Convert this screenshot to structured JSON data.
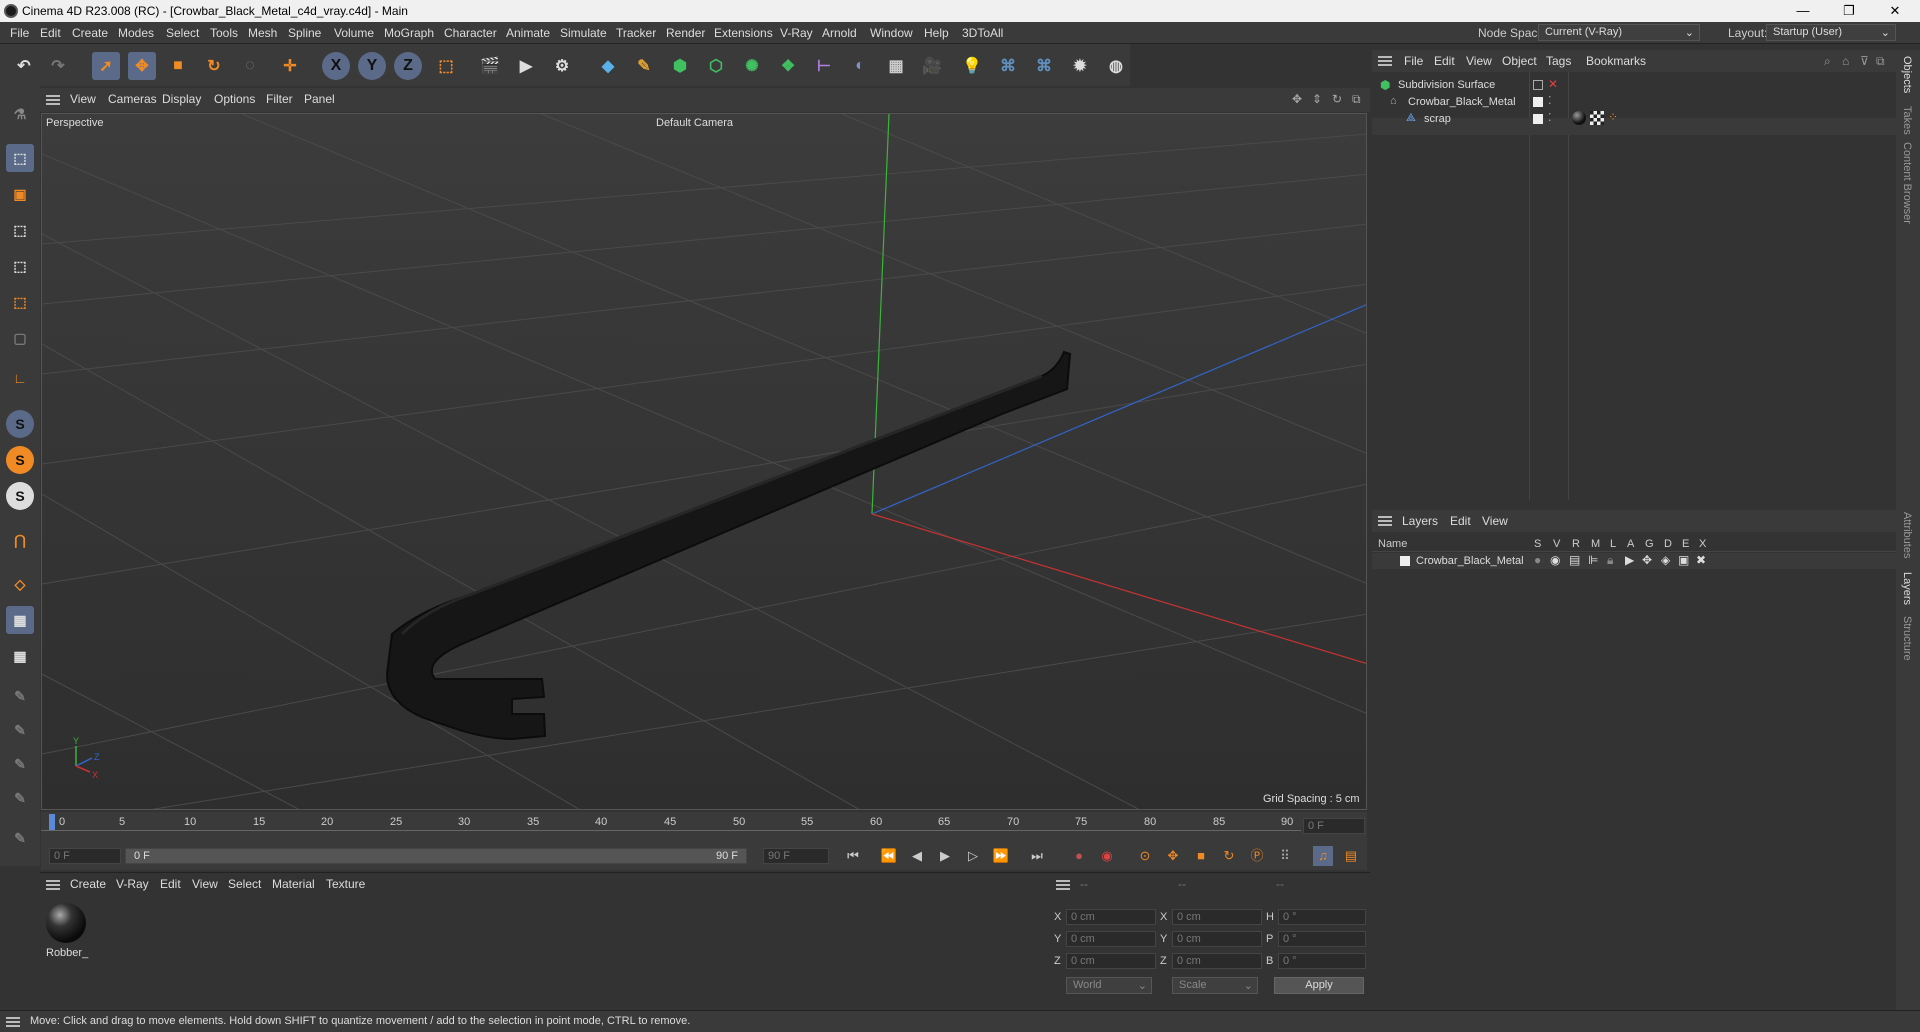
{
  "title": "Cinema 4D R23.008 (RC) - [Crowbar_Black_Metal_c4d_vray.c4d] - Main",
  "window_controls": {
    "minimize": "—",
    "maximize": "❐",
    "close": "✕"
  },
  "menu": [
    "File",
    "Edit",
    "Create",
    "Modes",
    "Select",
    "Tools",
    "Mesh",
    "Spline",
    "Volume",
    "MoGraph",
    "Character",
    "Animate",
    "Simulate",
    "Tracker",
    "Render",
    "Extensions",
    "V-Ray",
    "Arnold",
    "Window",
    "Help",
    "3DToAll"
  ],
  "node_space": {
    "label": "Node Space:",
    "value": "Current (V-Ray)"
  },
  "layout": {
    "label": "Layout:",
    "value": "Startup (User)"
  },
  "viewport": {
    "menu": [
      "View",
      "Cameras",
      "Display",
      "Options",
      "Filter",
      "Panel"
    ],
    "label": "Perspective",
    "camera": "Default Camera",
    "grid_spacing": "Grid Spacing : 5 cm"
  },
  "timeline": {
    "ticks": [
      "0",
      "5",
      "10",
      "15",
      "20",
      "25",
      "30",
      "35",
      "40",
      "45",
      "50",
      "55",
      "60",
      "65",
      "70",
      "75",
      "80",
      "85",
      "90"
    ],
    "current_frame": "0 F",
    "start": "0 F",
    "range_start": "0 F",
    "range_end": "90 F",
    "end": "90 F"
  },
  "material_panel": {
    "menu": [
      "Create",
      "V-Ray",
      "Edit",
      "View",
      "Select",
      "Material",
      "Texture"
    ],
    "materials": [
      {
        "name": "Robber_"
      }
    ]
  },
  "coords": {
    "headers": [
      "--",
      "--",
      "--"
    ],
    "rows": [
      {
        "a": "X",
        "av": "0 cm",
        "b": "X",
        "bv": "0 cm",
        "c": "H",
        "cv": "0 °"
      },
      {
        "a": "Y",
        "av": "0 cm",
        "b": "Y",
        "bv": "0 cm",
        "c": "P",
        "cv": "0 °"
      },
      {
        "a": "Z",
        "av": "0 cm",
        "b": "Z",
        "bv": "0 cm",
        "c": "B",
        "cv": "0 °"
      }
    ],
    "world": "World",
    "scale": "Scale",
    "apply": "Apply"
  },
  "status": "Move: Click and drag to move elements. Hold down SHIFT to quantize movement / add to the selection in point mode, CTRL to remove.",
  "objects": {
    "menu": [
      "File",
      "Edit",
      "View",
      "Object",
      "Tags",
      "Bookmarks"
    ],
    "tree": [
      {
        "name": "Subdivision Surface"
      },
      {
        "name": "Crowbar_Black_Metal"
      },
      {
        "name": "scrap"
      }
    ]
  },
  "layers": {
    "menu": [
      "Layers",
      "Edit",
      "View"
    ],
    "columns": [
      "Name",
      "S",
      "V",
      "R",
      "M",
      "L",
      "A",
      "G",
      "D",
      "E",
      "X"
    ],
    "rows": [
      {
        "name": "Crowbar_Black_Metal"
      }
    ]
  },
  "right_tabs": [
    "Objects",
    "Takes",
    "Content Browser",
    "Attributes",
    "Layers",
    "Structure"
  ],
  "colors": {
    "accent": "#f08a24",
    "x_axis": "#c83232",
    "y_axis": "#3cb43c",
    "z_axis": "#3264c8"
  }
}
